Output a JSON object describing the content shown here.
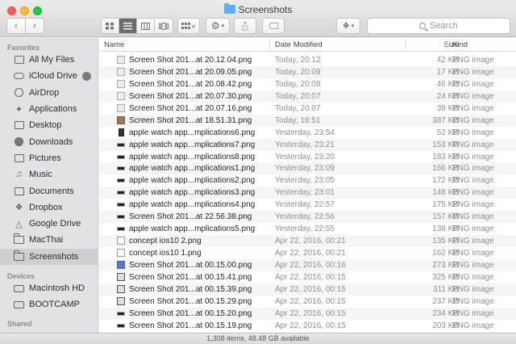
{
  "window": {
    "title": "Screenshots"
  },
  "toolbar": {
    "search_placeholder": "Search",
    "back_icon": "chevron-left",
    "forward_icon": "chevron-right"
  },
  "sidebar": {
    "favorites_label": "Favorites",
    "favorites": [
      {
        "label": "All My Files",
        "icon": "all-files-icon"
      },
      {
        "label": "iCloud Drive",
        "icon": "cloud-icon"
      },
      {
        "label": "AirDrop",
        "icon": "airdrop-icon"
      },
      {
        "label": "Applications",
        "icon": "applications-icon"
      },
      {
        "label": "Desktop",
        "icon": "desktop-icon"
      },
      {
        "label": "Downloads",
        "icon": "downloads-icon"
      },
      {
        "label": "Pictures",
        "icon": "pictures-icon"
      },
      {
        "label": "Music",
        "icon": "music-icon"
      },
      {
        "label": "Documents",
        "icon": "documents-icon"
      },
      {
        "label": "Dropbox",
        "icon": "dropbox-icon"
      },
      {
        "label": "Google Drive",
        "icon": "google-drive-icon"
      },
      {
        "label": "MacThai",
        "icon": "folder-icon"
      },
      {
        "label": "Screenshots",
        "icon": "folder-icon",
        "selected": true
      }
    ],
    "devices_label": "Devices",
    "devices": [
      {
        "label": "Macintosh HD",
        "icon": "hard-drive-icon"
      },
      {
        "label": "BOOTCAMP",
        "icon": "hard-drive-icon"
      }
    ],
    "shared_label": "Shared"
  },
  "columns": {
    "name": "Name",
    "date": "Date Modified",
    "size": "Size",
    "kind": "Kind"
  },
  "files": [
    {
      "name": "Screen Shot 201...at 20.12.04.png",
      "date": "Today, 20:12",
      "size": "42 KB",
      "kind": "PNG image",
      "thumb": "gray"
    },
    {
      "name": "Screen Shot 201...at 20.09.05.png",
      "date": "Today, 20:09",
      "size": "17 KB",
      "kind": "PNG image",
      "thumb": "gray"
    },
    {
      "name": "Screen Shot 201...at 20.08.42.png",
      "date": "Today, 20:08",
      "size": "46 KB",
      "kind": "PNG image",
      "thumb": "gray"
    },
    {
      "name": "Screen Shot 201...at 20.07.30.png",
      "date": "Today, 20:07",
      "size": "24 KB",
      "kind": "PNG image",
      "thumb": "gray"
    },
    {
      "name": "Screen Shot 201...at 20.07.16.png",
      "date": "Today, 20:07",
      "size": "39 KB",
      "kind": "PNG image",
      "thumb": "gray"
    },
    {
      "name": "Screen Shot 201...at 18.51.31.png",
      "date": "Today, 18:51",
      "size": "387 KB",
      "kind": "PNG image",
      "thumb": "brown"
    },
    {
      "name": "apple watch app...mplications6.png",
      "date": "Yesterday, 23:54",
      "size": "52 KB",
      "kind": "PNG image",
      "thumb": "dark"
    },
    {
      "name": "apple watch app...mplications7.png",
      "date": "Yesterday, 23:21",
      "size": "153 KB",
      "kind": "PNG image",
      "thumb": "bar"
    },
    {
      "name": "apple watch app...mplications8.png",
      "date": "Yesterday, 23:20",
      "size": "183 KB",
      "kind": "PNG image",
      "thumb": "bar"
    },
    {
      "name": "apple watch app...mplications1.png",
      "date": "Yesterday, 23:09",
      "size": "166 KB",
      "kind": "PNG image",
      "thumb": "bar"
    },
    {
      "name": "apple watch app...mplications2.png",
      "date": "Yesterday, 23:05",
      "size": "172 KB",
      "kind": "PNG image",
      "thumb": "bar"
    },
    {
      "name": "apple watch app...mplications3.png",
      "date": "Yesterday, 23:01",
      "size": "148 KB",
      "kind": "PNG image",
      "thumb": "bar"
    },
    {
      "name": "apple watch app...mplications4.png",
      "date": "Yesterday, 22:57",
      "size": "175 KB",
      "kind": "PNG image",
      "thumb": "bar"
    },
    {
      "name": "Screen Shot 201...at 22.56.38.png",
      "date": "Yesterday, 22:56",
      "size": "157 KB",
      "kind": "PNG image",
      "thumb": "bar"
    },
    {
      "name": "apple watch app...mplications5.png",
      "date": "Yesterday, 22:55",
      "size": "138 KB",
      "kind": "PNG image",
      "thumb": "bar"
    },
    {
      "name": "concept ios10 2.png",
      "date": "Apr 22, 2016, 00:21",
      "size": "135 KB",
      "kind": "PNG image",
      "thumb": "ios"
    },
    {
      "name": "concept ios10 1.png",
      "date": "Apr 22, 2016, 00:21",
      "size": "162 KB",
      "kind": "PNG image",
      "thumb": "ios"
    },
    {
      "name": "Screen Shot 201...at 00.15.00.png",
      "date": "Apr 22, 2016, 00:16",
      "size": "273 KB",
      "kind": "PNG image",
      "thumb": "teal"
    },
    {
      "name": "Screen Shot 201...at 00.15.41.png",
      "date": "Apr 22, 2016, 00:15",
      "size": "325 KB",
      "kind": "PNG image",
      "thumb": "face"
    },
    {
      "name": "Screen Shot 201...at 00.15.39.png",
      "date": "Apr 22, 2016, 00:15",
      "size": "311 KB",
      "kind": "PNG image",
      "thumb": "face"
    },
    {
      "name": "Screen Shot 201...at 00.15.29.png",
      "date": "Apr 22, 2016, 00:15",
      "size": "237 KB",
      "kind": "PNG image",
      "thumb": "face"
    },
    {
      "name": "Screen Shot 201...at 00.15.20.png",
      "date": "Apr 22, 2016, 00:15",
      "size": "234 KB",
      "kind": "PNG image",
      "thumb": "bar"
    },
    {
      "name": "Screen Shot 201...at 00.15.19.png",
      "date": "Apr 22, 2016, 00:15",
      "size": "203 KB",
      "kind": "PNG image",
      "thumb": "bar"
    }
  ],
  "status": {
    "text": "1,308 items, 48.48 GB available"
  },
  "colors": {
    "close": "#fc5f57",
    "minimize": "#fdbc2e",
    "maximize": "#29c840",
    "folder": "#5eaef3"
  }
}
